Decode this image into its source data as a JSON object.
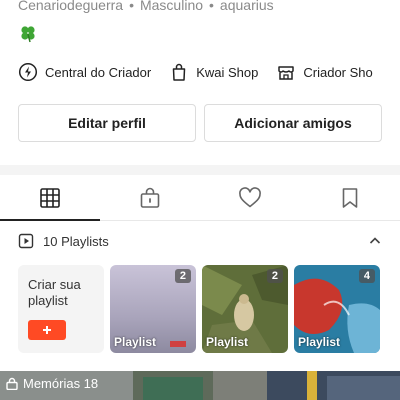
{
  "profile": {
    "username": "Cenariodeguerra",
    "gender": "Masculino",
    "sign": "aquarius",
    "separator": "•"
  },
  "shortcuts": [
    {
      "label": "Central do Criador",
      "icon": "lightning-icon"
    },
    {
      "label": "Kwai Shop",
      "icon": "shopping-bag-icon"
    },
    {
      "label": "Criador Sho",
      "icon": "store-icon"
    }
  ],
  "actions": {
    "edit_profile": "Editar perfil",
    "add_friends": "Adicionar amigos"
  },
  "tabs": [
    {
      "name": "grid",
      "icon": "grid-icon",
      "active": true
    },
    {
      "name": "private",
      "icon": "lock-bag-icon",
      "active": false
    },
    {
      "name": "likes",
      "icon": "heart-icon",
      "active": false
    },
    {
      "name": "saved",
      "icon": "bookmark-icon",
      "active": false
    }
  ],
  "playlists": {
    "header": "10 Playlists",
    "create_label": "Criar sua playlist",
    "items": [
      {
        "count": "2",
        "label": "Playlist"
      },
      {
        "count": "2",
        "label": "Playlist"
      },
      {
        "count": "4",
        "label": "Playlist"
      }
    ]
  },
  "memories": {
    "label": "Memórias 18"
  },
  "colors": {
    "accent": "#ff4a24",
    "text_primary": "#222222",
    "text_secondary": "#8a8a8a",
    "border": "#dcdcdc",
    "band": "#f4f4f4"
  }
}
